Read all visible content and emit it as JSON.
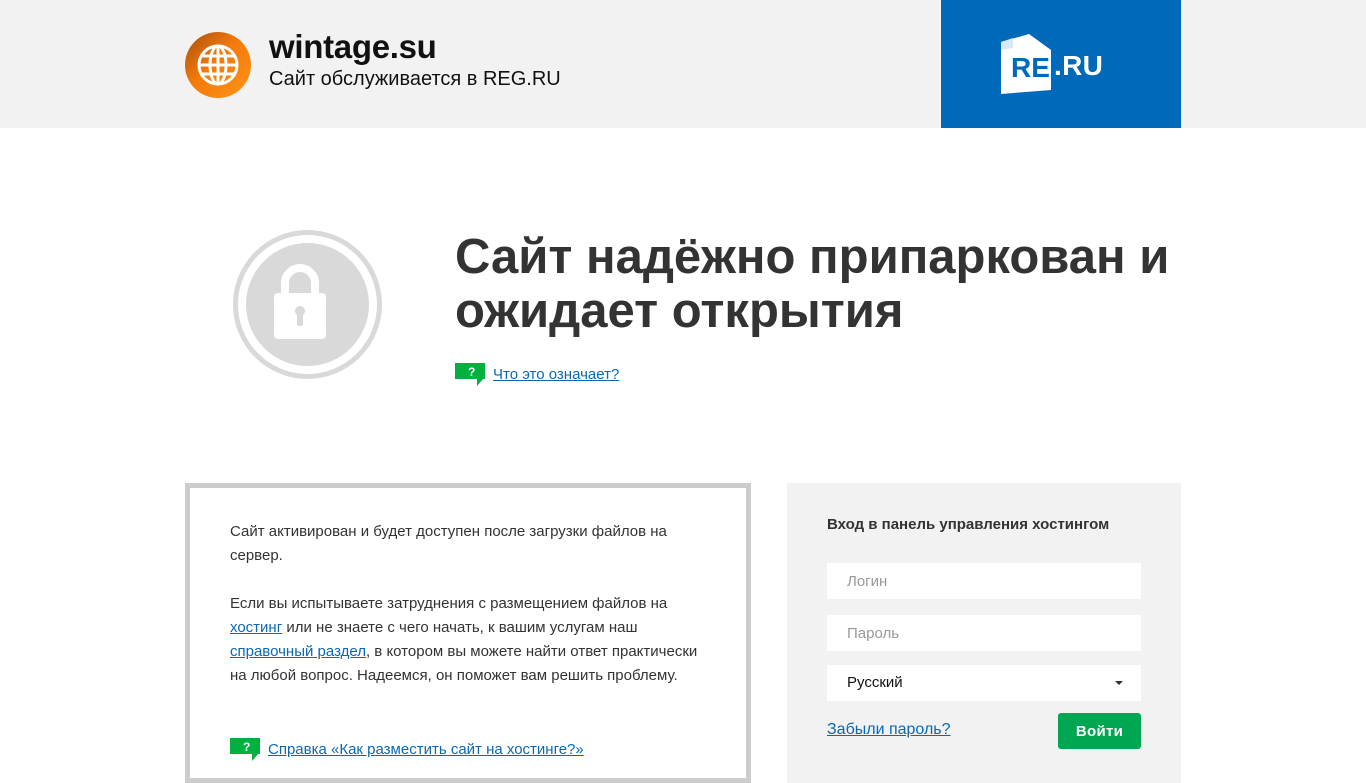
{
  "header": {
    "site_name": "wintage.su",
    "site_subtitle": "Сайт обслуживается в REG.RU",
    "brand_logo_text": "REG",
    "brand_logo_suffix": ".RU",
    "site_icon": "globe-icon",
    "brand_color": "#0069b9"
  },
  "hero": {
    "headline": "Сайт надёжно припаркован и ожидает открытия",
    "what_link": "Что это означает?",
    "lock_icon": "padlock-icon",
    "help_icon": "question-speech-bubble-icon"
  },
  "info": {
    "paragraph1": "Сайт активирован и будет доступен после загрузки файлов на сервер.",
    "p2_before": "Если вы испытываете затруднения с размещением файлов на ",
    "p2_link1": "хостинг",
    "p2_middle": " или не знаете с чего начать, к вашим услугам наш ",
    "p2_link2": "справочный раздел",
    "p2_after": ", в котором вы можете найти ответ практически на любой вопрос. Надеемся, он поможет вам решить проблему.",
    "help_link": "Справка «Как разместить сайт на хостинге?»"
  },
  "login": {
    "title": "Вход в панель управления хостингом",
    "login_placeholder": "Логин",
    "password_placeholder": "Пароль",
    "language": "Русский",
    "forgot_link": "Забыли пароль?",
    "submit_label": "Войти",
    "button_color": "#00a651"
  }
}
